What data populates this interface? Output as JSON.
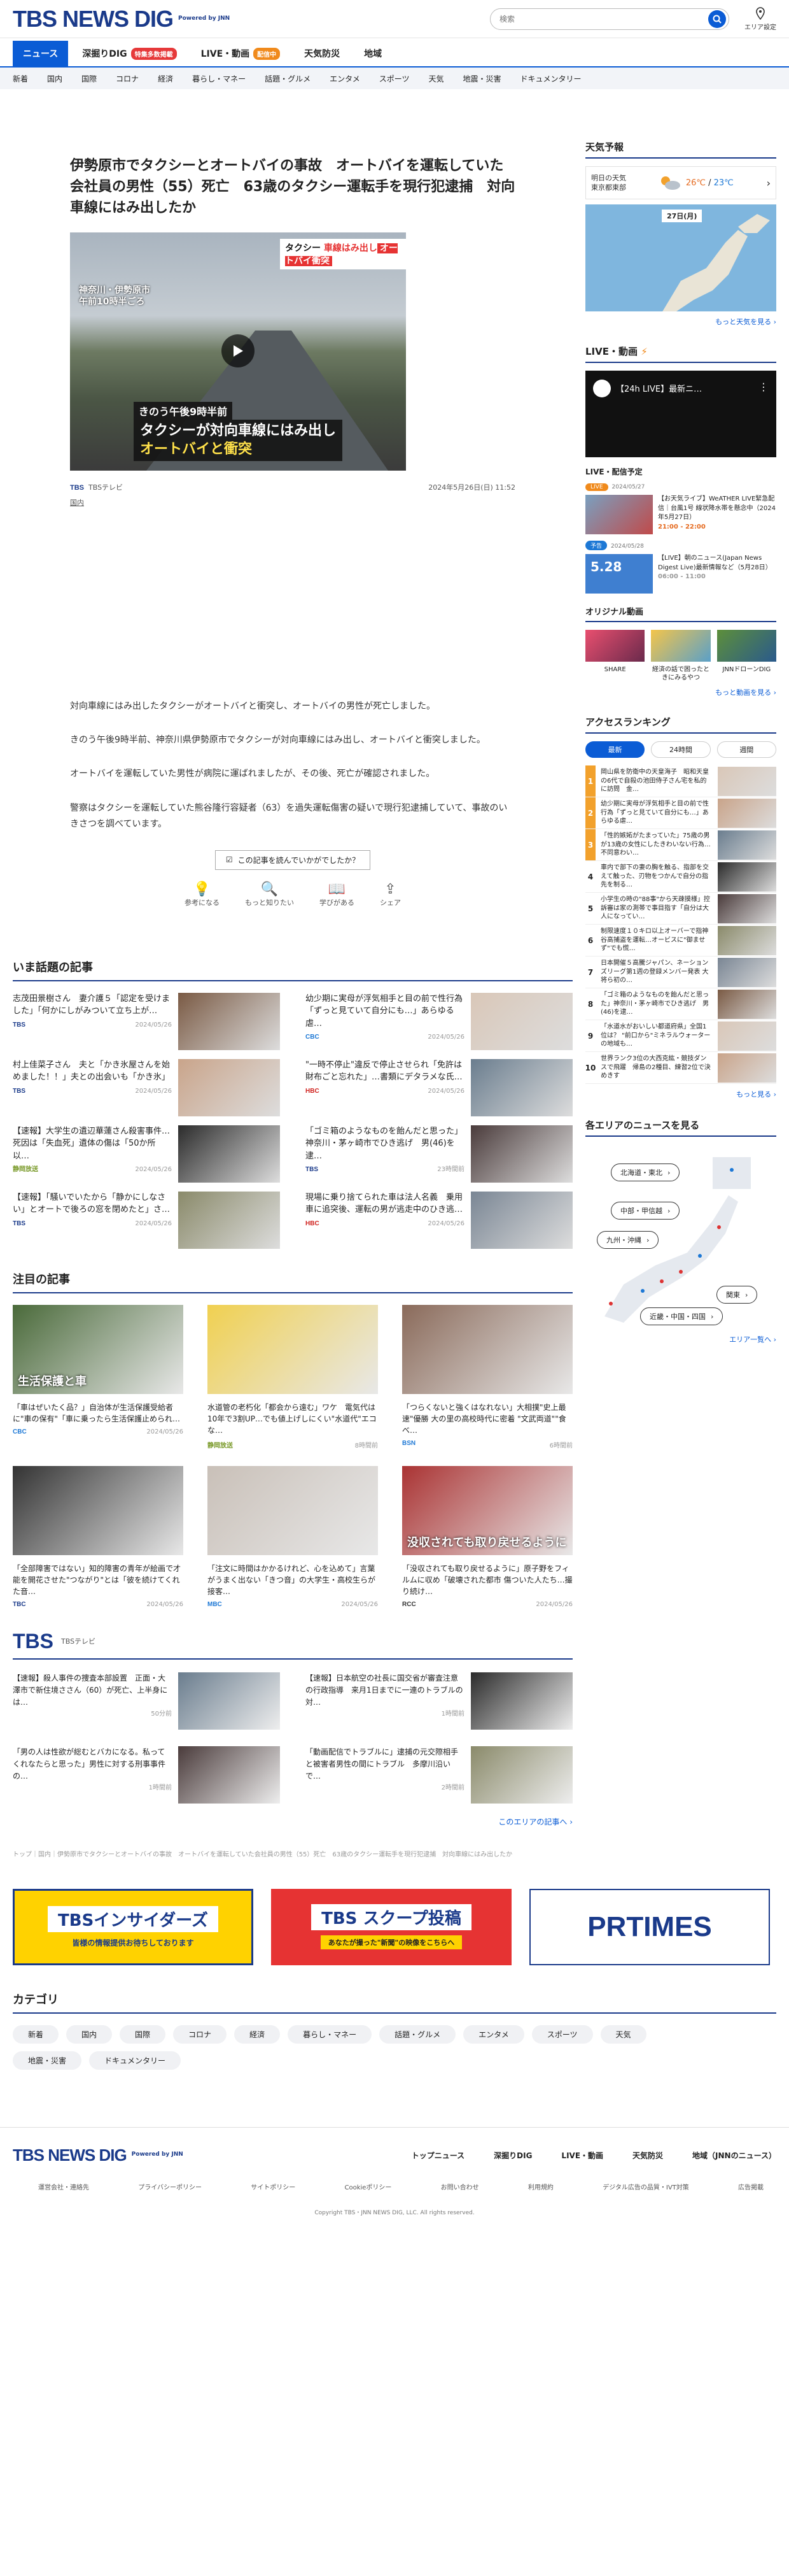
{
  "header": {
    "logo": "TBS NEWS DIG",
    "powered": "Powered by JNN",
    "search_placeholder": "検索",
    "area_label": "エリア設定"
  },
  "nav1": [
    {
      "label": "ニュース",
      "active": true
    },
    {
      "label": "深掘りDIG",
      "badge": "特集多数掲載",
      "badge_color": "#e6393a"
    },
    {
      "label": "LIVE・動画",
      "badge": "配信中",
      "badge_color": "#f08a1c"
    },
    {
      "label": "天気防災"
    },
    {
      "label": "地域"
    }
  ],
  "nav2": [
    "新着",
    "国内",
    "国際",
    "コロナ",
    "経済",
    "暮らし・マネー",
    "話題・グルメ",
    "エンタメ",
    "スポーツ",
    "天気",
    "地震・災害",
    "ドキュメンタリー"
  ],
  "article": {
    "title": "伊勢原市でタクシーとオートバイの事故　オートバイを運転していた会社員の男性（55）死亡　63歳のタクシー運転手を現行犯逮捕　対向車線にはみ出したか",
    "img_chip_a": "タクシー",
    "img_chip_b": "車線はみ出し",
    "img_chip_c": "オートバイ衝突",
    "img_loc1": "神奈川・伊勢原市",
    "img_loc2": "午前10時半ごろ",
    "img_cap1": "きのう午後9時半前",
    "img_cap2a": "タクシーが対向車線にはみ出し",
    "img_cap2b": "オートバイと衝突",
    "source_logo": "TBS",
    "source": "TBSテレビ",
    "date": "2024年5月26日(日) 11:52",
    "category": "国内",
    "paragraphs": [
      "対向車線にはみ出したタクシーがオートバイと衝突し、オートバイの男性が死亡しました。",
      "きのう午後9時半前、神奈川県伊勢原市でタクシーが対向車線にはみ出し、オートバイと衝突しました。",
      "オートバイを運転していた男性が病院に運ばれましたが、その後、死亡が確認されました。",
      "警察はタクシーを運転していた熊谷隆行容疑者（63）を過失運転傷害の疑いで現行犯逮捕していて、事故のいきさつを調べています。"
    ],
    "feedback_q": "この記事を読んでいかがでしたか？",
    "reactions": [
      "参考になる",
      "もっと知りたい",
      "学びがある",
      "シェア"
    ]
  },
  "topics": {
    "heading": "いま話題の記事",
    "items": [
      {
        "title": "志茂田景樹さん　妻介護５「認定を受けました」「何かにしがみついて立ち上が…",
        "src": "TBS",
        "src_color": "#1a3a8a",
        "date": "2024/05/26"
      },
      {
        "title": "幼少期に実母が浮気相手と目の前で性行為「ずっと見ていて自分にも…」あらゆる虐…",
        "src": "CBC",
        "src_color": "#1d78d5",
        "date": "2024/05/26"
      },
      {
        "title": "村上佳菜子さん　夫と「かき氷屋さんを始めました！！」夫との出会いも「かき氷」",
        "src": "TBS",
        "src_color": "#1a3a8a",
        "date": "2024/05/26"
      },
      {
        "title": "\"一時不停止\"違反で停止させられ「免許は財布ごと忘れた」…書類にデタラメな氏…",
        "src": "HBC",
        "src_color": "#d0231f",
        "date": "2024/05/26"
      },
      {
        "title": "【速報】大学生の遺辺華蓮さん殺害事件…死因は「失血死」遺体の傷は「50か所以…",
        "src": "静岡放送",
        "src_color": "#7a9a2a",
        "date": "2024/05/26"
      },
      {
        "title": "「ゴミ箱のようなものを飴んだと思った」神奈川・茅ヶ崎市でひき逃げ　男(46)を逮…",
        "src": "TBS",
        "src_color": "#1a3a8a",
        "date": "23時間前"
      },
      {
        "title": "【速報】「騒いでいたから「静かにしなさい」とオートで後ろの窓を閉めたと」さ…",
        "src": "TBS",
        "src_color": "#1a3a8a",
        "date": "2024/05/26"
      },
      {
        "title": "現場に乗り捨てられた車は法人名義　乗用車に追突後、運転の男が逃走中のひき逃…",
        "src": "HBC",
        "src_color": "#d0231f",
        "date": "2024/05/26"
      }
    ]
  },
  "notes": {
    "heading": "注目の記事",
    "items": [
      {
        "title": "「車はぜいたく品？」自治体が生活保護受給者に\"車の保有\"「車に乗ったら生活保護止められ…",
        "src": "CBC",
        "src_color": "#1d78d5",
        "date": "2024/05/26",
        "img_text": "生活保護と車"
      },
      {
        "title": "水道管の老朽化「都会から遠む」ワケ　電気代は10年で3割UP…でも値上げしにくい\"水道代\"エコな…",
        "src": "静岡放送",
        "src_color": "#7a9a2a",
        "date": "8時間前",
        "img_text": ""
      },
      {
        "title": "「つらくないと強くはなれない」大相撲\"史上最速\"優勝 大の里の高校時代に密着 \"文武両道\"\"食べ…",
        "src": "BSN",
        "src_color": "#1d78d5",
        "date": "6時間前",
        "img_text": ""
      },
      {
        "title": "「全部障害ではない」知的障害の青年が絵画で才能を開花させた\"つながり\"とは「彼を続けてくれた音…",
        "src": "TBC",
        "src_color": "#1a3a8a",
        "date": "2024/05/26",
        "img_text": ""
      },
      {
        "title": "「注文に時間はかかるけれど、心を込めて」言葉がうまく出ない「きつ音」の大学生・高校生らが接客…",
        "src": "MBC",
        "src_color": "#1d78d5",
        "date": "2024/05/26",
        "img_text": ""
      },
      {
        "title": "「没収されても取り戻せるように」原子野をフィルムに収め「破壊された都市 傷ついた人たち…撮り続け…",
        "src": "RCC",
        "src_color": "#333333",
        "date": "2024/05/26",
        "img_text": "没収されても取り戻せるように"
      }
    ]
  },
  "tbs": {
    "logo": "TBS",
    "sub": "TBSテレビ",
    "items": [
      {
        "title": "【速報】殺人事件の捜査本部設置　正面・大澤市で新住境ささん（60）が死亡、上半身には…",
        "date": "50分前"
      },
      {
        "title": "【速報】日本航空の社長に国交省が審査注意の行政指導　来月1日までに一連のトラブルの対…",
        "date": "1時間前"
      },
      {
        "title": "「男の人は性欲が総むとバカになる。私ってくれなたらと思った」男性に対する刑事事件の…",
        "date": "1時間前"
      },
      {
        "title": "「動画配信でトラブルに」逮捕の元交際相手と被害者男性の間にトラブル　多摩川沿いで…",
        "date": "2時間前"
      }
    ],
    "more": "このエリアの記事へ"
  },
  "breadcrumb": "トップ｜国内｜伊勢原市でタクシーとオートバイの事故　オートバイを運転していた会社員の男性（55）死亡　63歳のタクシー運転手を現行犯逮捕　対向車線にはみ出したか",
  "banners": {
    "insider_title": "TBSインサイダーズ",
    "insider_sub": "皆様の情報提供お待ちしております",
    "scoop_title": "TBS スクープ投稿",
    "scoop_sub": "あなたが撮った\"新聞\"の映像をこちらへ",
    "prtimes": "PRTIMES"
  },
  "categories": {
    "heading": "カテゴリ",
    "items": [
      "新着",
      "国内",
      "国際",
      "コロナ",
      "経済",
      "暮らし・マネー",
      "話題・グルメ",
      "エンタメ",
      "スポーツ",
      "天気",
      "地震・災害",
      "ドキュメンタリー"
    ]
  },
  "footer": {
    "logo": "TBS NEWS DIG",
    "powered": "Powered by JNN",
    "nav": [
      "トップニュース",
      "深掘りDIG",
      "LIVE・動画",
      "天気防災",
      "地域（JNNのニュース）"
    ],
    "links": [
      "運営会社・連絡先",
      "プライバシーポリシー",
      "サイトポリシー",
      "Cookieポリシー",
      "お問い合わせ",
      "利用規約",
      "デジタル広告の品質・IVT対策",
      "広告掲載"
    ],
    "copyright": "Copyright TBS・JNN NEWS DIG, LLC. All rights reserved."
  },
  "side": {
    "weather": {
      "heading": "天気予報",
      "sel1": "明日の天気",
      "sel2": "東京都東部",
      "high": "26℃",
      "low": "23℃",
      "date": "27日(月)",
      "more": "もっと天気を見る"
    },
    "live": {
      "heading": "LIVE・動画",
      "title": "【24h LIVE】最新ニ…"
    },
    "schedule": {
      "heading": "LIVE・配信予定",
      "items": [
        {
          "tag": "LIVE",
          "tag_color": "#f08a1c",
          "date": "2024/05/27",
          "title": "【お天気ライブ】WeATHER LIVE緊急配信｜台風1号 線状降水帯を懸念中（2024年5月27日）",
          "time": "21:00 - 22:00",
          "thumb_text": ""
        },
        {
          "tag": "予告",
          "tag_color": "#1d78d5",
          "date": "2024/05/28",
          "title": "【LIVE】朝のニュース(Japan News Digest Live)最新情報など（5月28日）",
          "time": "06:00 - 11:00",
          "thumb_text": "5.28"
        }
      ]
    },
    "original": {
      "heading": "オリジナル動画",
      "items": [
        "SHARE",
        "経済の話で困ったときにみるやつ",
        "JNNドローンDIG"
      ],
      "more": "もっと動画を見る"
    },
    "ranking": {
      "heading": "アクセスランキング",
      "tabs": [
        "最新",
        "24時間",
        "週間"
      ],
      "items": [
        "岡山県を防衛中の天皇海子　昭和天皇の6代で自殺の池田侍子さん宅を私的に訪問　金…",
        "幼少期に実母が浮気相手と目の前で性行為「ずっと見ていて自分にも…」あらゆる虐…",
        "「性的嫉妬がたまっていた」75歳の男が13歳の女性にしたきわいない行為…不同意わい…",
        "車内で部下の妻の胸を触る、指部を交えて触った、刃物をつかんで自分の指先を制る…",
        "小学生の時の\"88事\"から天疎摸様」控訴審は家の測帯で事目指す「自分は大人になってい…",
        "制限速度１０キロ以上オーバーで指神谷高捕盗を運転…オービスに\"御ませず\"でも慌…",
        "日本開催５高騰ジャパン、ネーションズリーグ第1週の登録メンバー発表 大将ら初の…",
        "「ゴミ箱のようなものを飴んだと思った」神奈川・茅ヶ崎市でひき逃げ　男(46)を逮…",
        "「水道水がおいしい都道府県」全国1位は？ \"前口から\"ミネラルウォーターの地域も…",
        "世界ランク3位の大西克紘・競技ダンスで飛躍　帰島の2種目、練習2位で決めきす"
      ],
      "more": "もっと見る"
    },
    "areas": {
      "heading": "各エリアのニュースを見る",
      "items": [
        "北海道・東北",
        "中部・甲信越",
        "九州・沖縄",
        "関東",
        "近畿・中国・四国"
      ],
      "more": "エリア一覧へ"
    }
  }
}
